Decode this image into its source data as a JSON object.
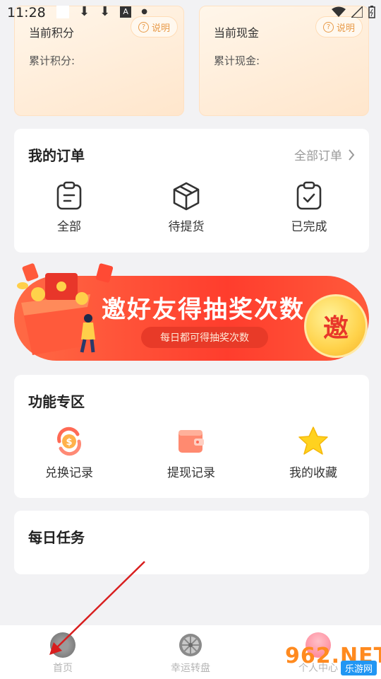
{
  "status_bar": {
    "time": "11:28"
  },
  "points_card": {
    "title": "当前积分",
    "accumulated_label": "累计积分:",
    "help_label": "说明"
  },
  "cash_card": {
    "title": "当前现金",
    "accumulated_label": "累计现金:",
    "help_label": "说明"
  },
  "orders": {
    "title": "我的订单",
    "all_link": "全部订单",
    "items": [
      {
        "label": "全部",
        "icon": "clipboard-list-icon"
      },
      {
        "label": "待提货",
        "icon": "package-box-icon"
      },
      {
        "label": "已完成",
        "icon": "clipboard-check-icon"
      }
    ]
  },
  "invite_banner": {
    "headline": "邀好友得抽奖次数",
    "subline": "每日都可得抽奖次数",
    "button": "邀"
  },
  "features": {
    "title": "功能专区",
    "items": [
      {
        "label": "兑换记录",
        "icon": "coin-exchange-icon"
      },
      {
        "label": "提现记录",
        "icon": "wallet-icon"
      },
      {
        "label": "我的收藏",
        "icon": "star-icon"
      }
    ]
  },
  "daily_tasks": {
    "title": "每日任务"
  },
  "tabbar": {
    "items": [
      {
        "label": "首页",
        "icon": "home-icon"
      },
      {
        "label": "幸运转盘",
        "icon": "lucky-wheel-icon"
      },
      {
        "label": "个人中心",
        "icon": "profile-icon"
      }
    ]
  },
  "watermark": {
    "number": "962.NET",
    "text": "乐游网"
  },
  "colors": {
    "accent": "#ff4a34",
    "card_bg": "#ffffff",
    "page_bg": "#f2f2f4",
    "gold": "#ffd24a"
  }
}
